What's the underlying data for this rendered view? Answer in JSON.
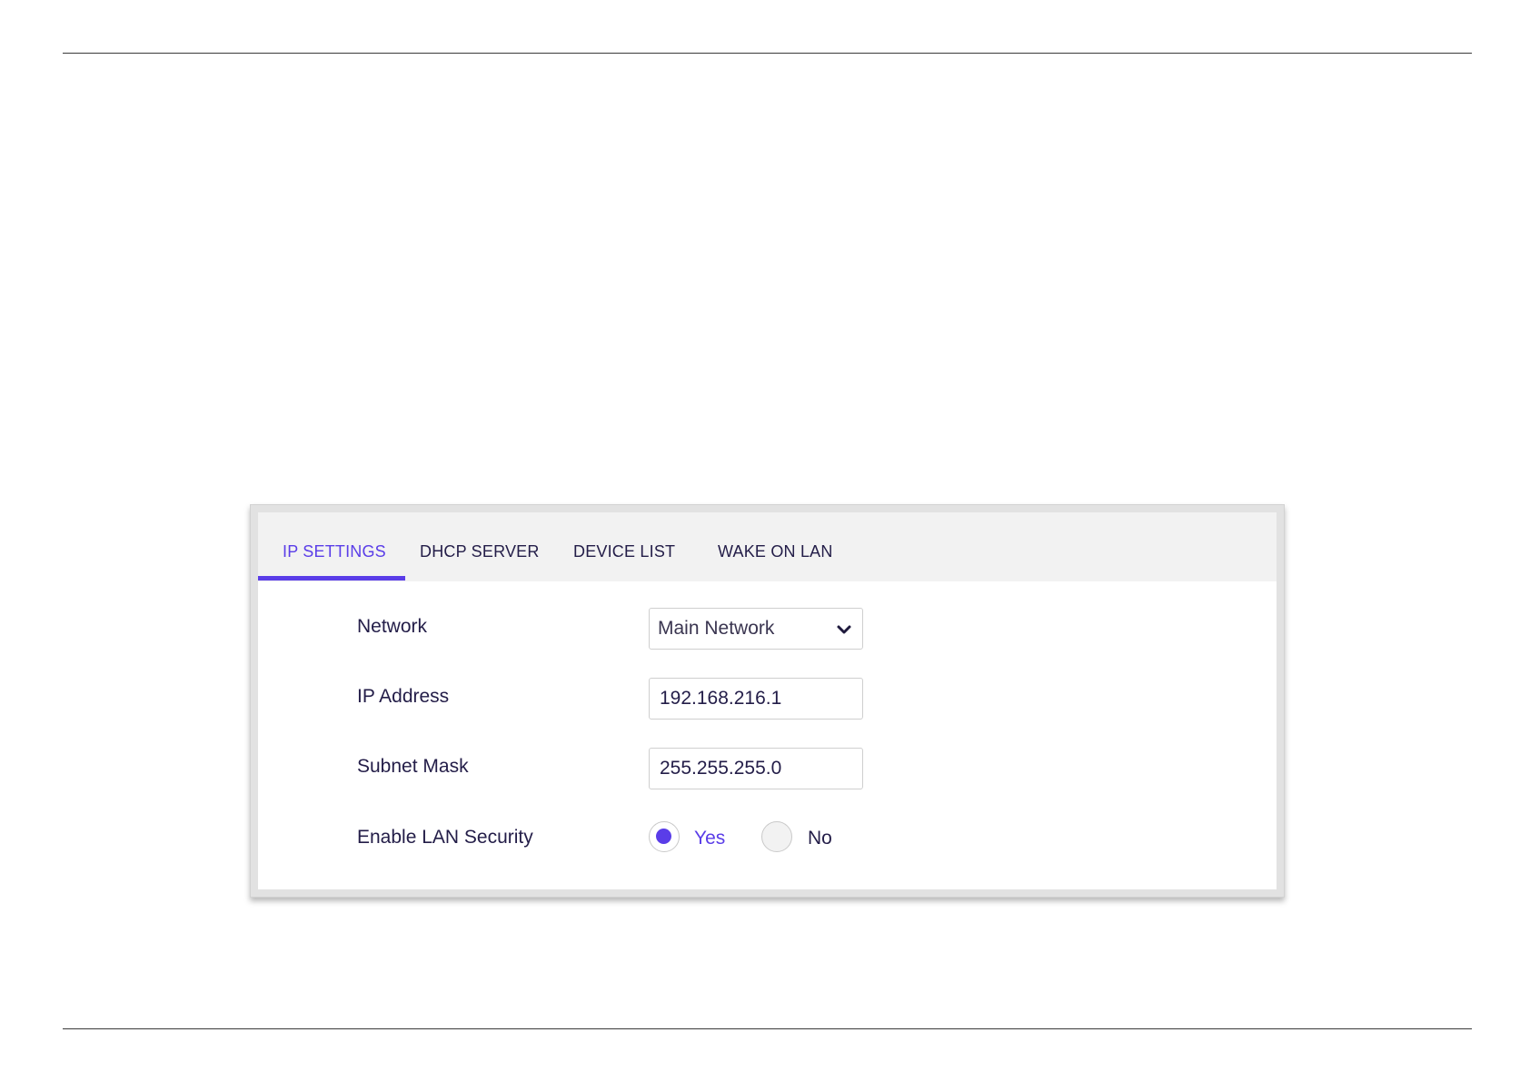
{
  "tabs": [
    {
      "label": "IP SETTINGS",
      "active": true
    },
    {
      "label": "DHCP SERVER",
      "active": false
    },
    {
      "label": "DEVICE LIST",
      "active": false
    },
    {
      "label": "WAKE ON LAN",
      "active": false
    }
  ],
  "form": {
    "network": {
      "label": "Network",
      "selected": "Main Network"
    },
    "ip_address": {
      "label": "IP Address",
      "value": "192.168.216.1"
    },
    "subnet_mask": {
      "label": "Subnet Mask",
      "value": "255.255.255.0"
    },
    "lan_security": {
      "label": "Enable LAN Security",
      "options": [
        {
          "label": "Yes",
          "checked": true
        },
        {
          "label": "No",
          "checked": false
        }
      ]
    }
  },
  "icons": {
    "dropdown": "chevron-down-icon"
  },
  "colors": {
    "accent": "#5a3de8",
    "text": "#231d48",
    "tab_bar_background": "#f2f2f2",
    "panel_frame": "#e2e2e2"
  }
}
